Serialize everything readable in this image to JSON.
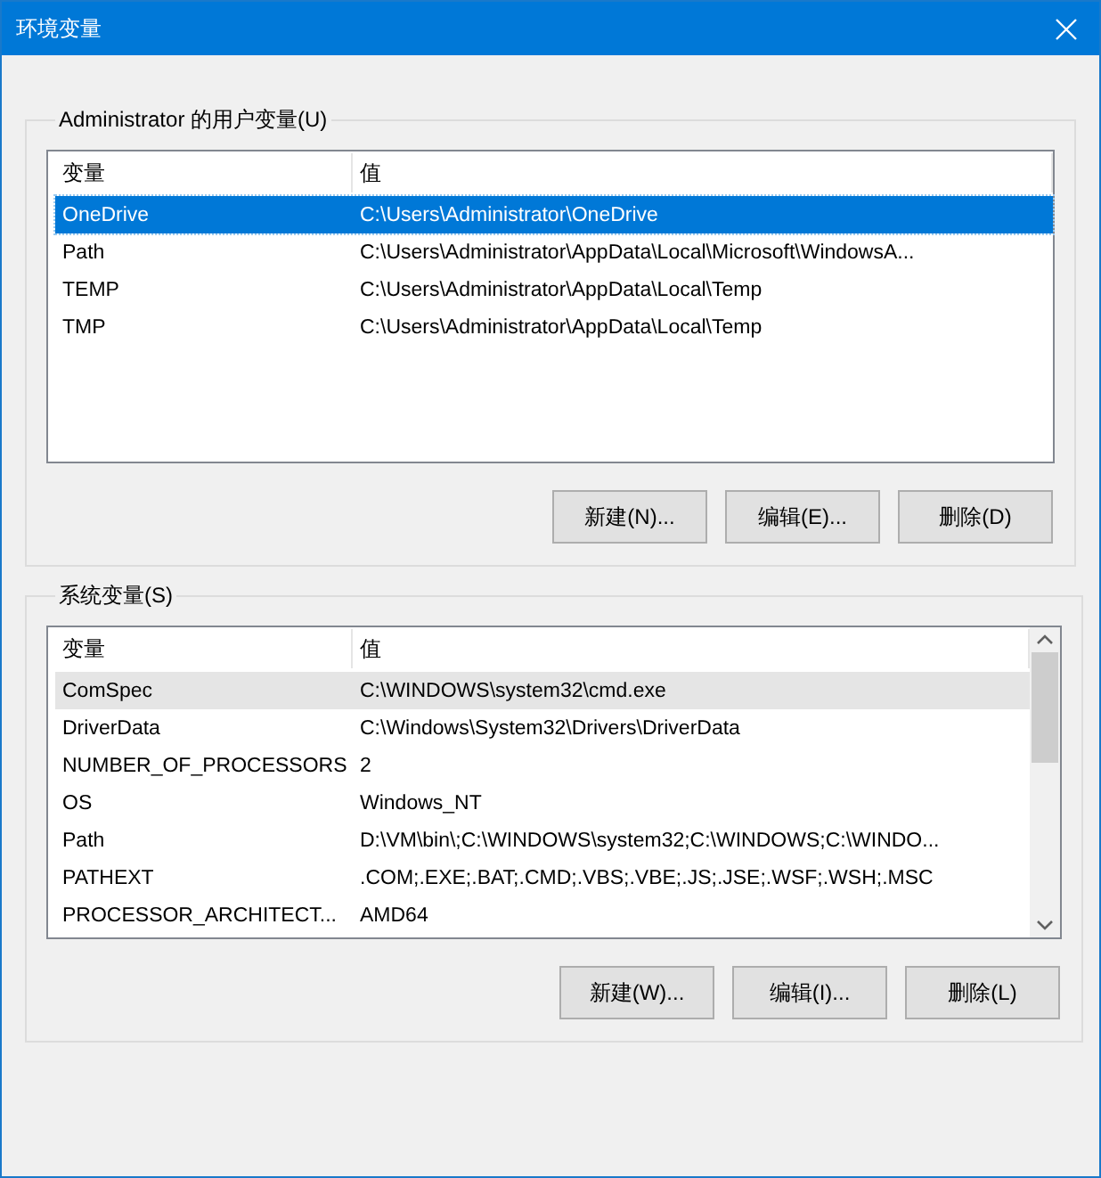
{
  "window": {
    "title": "环境变量"
  },
  "user_variables": {
    "label": "Administrator 的用户变量(U)",
    "focused": true,
    "scrollable": false,
    "columns": [
      "变量",
      "值"
    ],
    "rows": [
      {
        "name": "OneDrive",
        "value": "C:\\Users\\Administrator\\OneDrive",
        "selected": true
      },
      {
        "name": "Path",
        "value": "C:\\Users\\Administrator\\AppData\\Local\\Microsoft\\WindowsA...",
        "selected": false
      },
      {
        "name": "TEMP",
        "value": "C:\\Users\\Administrator\\AppData\\Local\\Temp",
        "selected": false
      },
      {
        "name": "TMP",
        "value": "C:\\Users\\Administrator\\AppData\\Local\\Temp",
        "selected": false
      }
    ],
    "buttons": [
      "新建(N)...",
      "编辑(E)...",
      "删除(D)"
    ]
  },
  "system_variables": {
    "label": "系统变量(S)",
    "focused": false,
    "scrollable": true,
    "columns": [
      "变量",
      "值"
    ],
    "rows": [
      {
        "name": "ComSpec",
        "value": "C:\\WINDOWS\\system32\\cmd.exe",
        "selected": true
      },
      {
        "name": "DriverData",
        "value": "C:\\Windows\\System32\\Drivers\\DriverData",
        "selected": false
      },
      {
        "name": "NUMBER_OF_PROCESSORS",
        "value": "2",
        "selected": false
      },
      {
        "name": "OS",
        "value": "Windows_NT",
        "selected": false
      },
      {
        "name": "Path",
        "value": "D:\\VM\\bin\\;C:\\WINDOWS\\system32;C:\\WINDOWS;C:\\WINDO...",
        "selected": false
      },
      {
        "name": "PATHEXT",
        "value": ".COM;.EXE;.BAT;.CMD;.VBS;.VBE;.JS;.JSE;.WSF;.WSH;.MSC",
        "selected": false
      },
      {
        "name": "PROCESSOR_ARCHITECT...",
        "value": "AMD64",
        "selected": false
      }
    ],
    "buttons": [
      "新建(W)...",
      "编辑(I)...",
      "删除(L)"
    ]
  }
}
